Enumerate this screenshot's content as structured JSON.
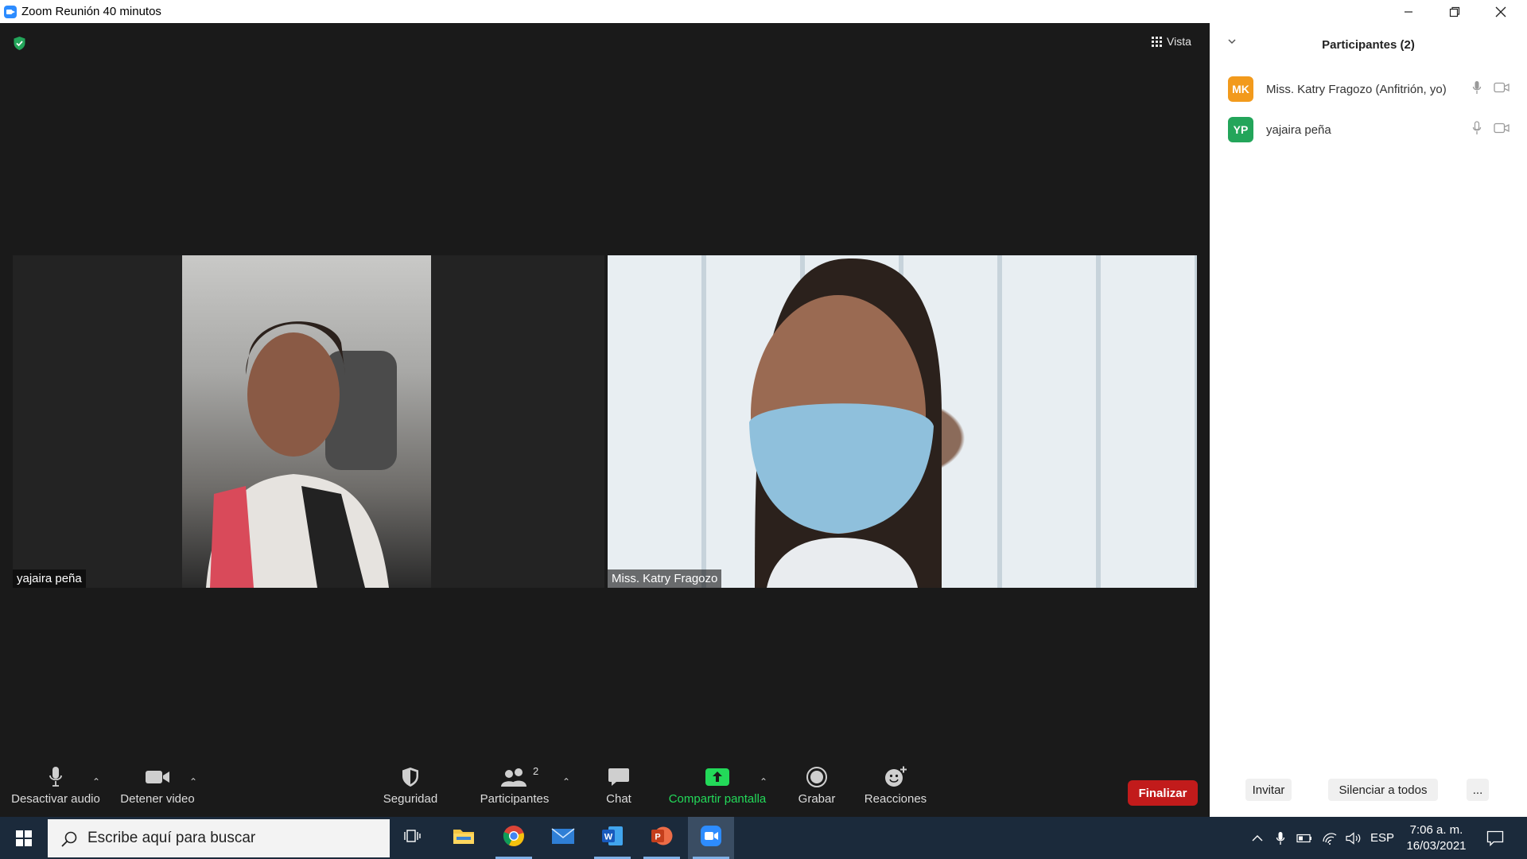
{
  "window": {
    "title": "Zoom Reunión 40 minutos"
  },
  "meeting": {
    "view_label": "Vista",
    "tiles": [
      {
        "name": "yajaira peña"
      },
      {
        "name": "Miss. Katry Fragozo"
      }
    ]
  },
  "toolbar": {
    "mute": "Desactivar audio",
    "video": "Detener video",
    "security": "Seguridad",
    "participants": "Participantes",
    "participants_count": "2",
    "chat": "Chat",
    "share": "Compartir pantalla",
    "record": "Grabar",
    "reactions": "Reacciones",
    "end": "Finalizar"
  },
  "panel": {
    "title": "Participantes (2)",
    "participants": [
      {
        "initials": "MK",
        "name": "Miss. Katry Fragozo (Anfitrión, yo)",
        "color": "#f29a1c"
      },
      {
        "initials": "YP",
        "name": "yajaira peña",
        "color": "#23a55a"
      }
    ],
    "invite": "Invitar",
    "mute_all": "Silenciar a todos",
    "more": "..."
  },
  "taskbar": {
    "search_placeholder": "Escribe aquí para buscar",
    "language": "ESP",
    "time": "7:06 a. m.",
    "date": "16/03/2021"
  },
  "colors": {
    "accent_share": "#23d959",
    "end_button": "#c21b1b",
    "security_shield": "#23a55a"
  }
}
